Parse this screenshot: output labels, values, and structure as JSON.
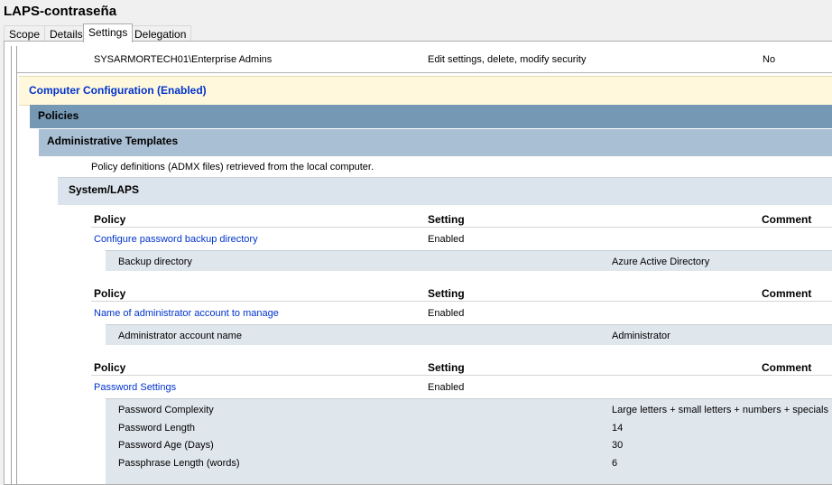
{
  "window": {
    "title": "LAPS-contraseña"
  },
  "tabs": [
    {
      "label": "Scope"
    },
    {
      "label": "Details"
    },
    {
      "label": "Settings"
    },
    {
      "label": "Delegation"
    }
  ],
  "delegation_row": {
    "name": "SYSARMORTECH01\\Enterprise Admins",
    "permission": "Edit settings, delete, modify security",
    "inherited": "No"
  },
  "computer_config": {
    "label": "Computer Configuration (Enabled)"
  },
  "policies_band": {
    "label": "Policies"
  },
  "admin_templates": {
    "label": "Administrative Templates",
    "note": "Policy definitions (ADMX files) retrieved from the local computer."
  },
  "system_laps": {
    "label": "System/LAPS"
  },
  "columns": {
    "policy": "Policy",
    "setting": "Setting",
    "comment": "Comment"
  },
  "groups": [
    {
      "policy": "Configure password backup directory",
      "state": "Enabled",
      "details": [
        {
          "name": "Backup directory",
          "value": "Azure Active Directory"
        }
      ]
    },
    {
      "policy": "Name of administrator account to manage",
      "state": "Enabled",
      "details": [
        {
          "name": "Administrator account name",
          "value": "Administrator"
        }
      ]
    },
    {
      "policy": "Password Settings",
      "state": "Enabled",
      "details": [
        {
          "name": "Password Complexity",
          "value": "Large letters + small letters + numbers + specials"
        },
        {
          "name": "Password Length",
          "value": "14"
        },
        {
          "name": "Password Age (Days)",
          "value": "30"
        },
        {
          "name": "Passphrase Length (words)",
          "value": "6"
        }
      ]
    }
  ]
}
